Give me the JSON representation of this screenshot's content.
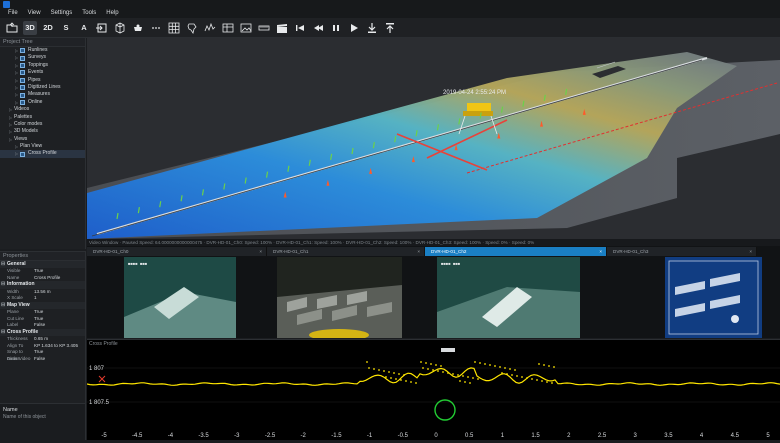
{
  "menu": [
    "File",
    "View",
    "Settings",
    "Tools",
    "Help"
  ],
  "toolbar": {
    "view_3d": "3D",
    "view_2d": "2D",
    "view_s": "S",
    "view_a": "A"
  },
  "project_tree": {
    "title": "Project Tree",
    "items": [
      {
        "label": "Runlines",
        "level": 1,
        "checked": true
      },
      {
        "label": "Surveys",
        "level": 1,
        "checked": true
      },
      {
        "label": "Toppings",
        "level": 1,
        "checked": true
      },
      {
        "label": "Events",
        "level": 1,
        "checked": true
      },
      {
        "label": "Pipes",
        "level": 1,
        "checked": true
      },
      {
        "label": "Digitized Lines",
        "level": 1,
        "checked": true
      },
      {
        "label": "Measures",
        "level": 1,
        "checked": true
      },
      {
        "label": "Online",
        "level": 1,
        "checked": true
      },
      {
        "label": "Videos",
        "level": 0,
        "checked": false
      },
      {
        "label": "Palettes",
        "level": 0,
        "checked": false
      },
      {
        "label": "Color modes",
        "level": 0,
        "checked": false
      },
      {
        "label": "3D Models",
        "level": 0,
        "checked": false
      },
      {
        "label": "Views",
        "level": 0,
        "checked": false
      },
      {
        "label": "Plan View",
        "level": 1,
        "checked": false
      },
      {
        "label": "Cross Profile",
        "level": 1,
        "checked": true
      }
    ]
  },
  "properties": {
    "title": "Properties",
    "sections": [
      {
        "name": "General",
        "rows": [
          [
            "Visible",
            "True"
          ],
          [
            "Name",
            "Cross Profile"
          ]
        ]
      },
      {
        "name": "Information",
        "rows": [
          [
            "Width",
            "13.56 m"
          ],
          [
            "X Scale",
            "1"
          ]
        ]
      },
      {
        "name": "Map View",
        "rows": [
          [
            "Plane",
            "True"
          ],
          [
            "Cut Line",
            "True"
          ],
          [
            "Label",
            "False"
          ]
        ]
      },
      {
        "name": "Cross Profile",
        "rows": [
          [
            "Thickness",
            "0.65 m"
          ],
          [
            "Align To",
            "KP 1.634 to KP 3.405"
          ],
          [
            "Snap to nadas",
            "True"
          ],
          [
            "Dims Video",
            "False"
          ]
        ]
      }
    ]
  },
  "description": {
    "title": "Name",
    "text": "Name of this object"
  },
  "scene": {
    "label": "2019-04-24\n2:55:24 PM"
  },
  "video": {
    "status": "Video Window · Paused Speed: 64.0000000000000475 · DVR-HD-01_Ch0: Speed: 100% · DVR-HD-01_Ch1: Speed: 100% · DVR-HD-01_Ch2: Speed: 100% · DVR-HD-01_Ch3: Speed: 100% · Speed: 0% · Speed: 0%",
    "tabs": [
      {
        "label": "DVR-HD-01_Ch0",
        "active": false
      },
      {
        "label": "DVR-HD-01_Ch1",
        "active": false
      },
      {
        "label": "DVR-HD-01_Ch2",
        "active": true
      },
      {
        "label": "DVR-HD-01_Ch3",
        "active": false
      }
    ]
  },
  "profile": {
    "title": "Cross Profile",
    "y_labels": [
      "1 807",
      "1 807.5"
    ],
    "x_ticks": [
      "-5",
      "-4.5",
      "-4",
      "-3.5",
      "-3",
      "-2.5",
      "-2",
      "-1.5",
      "-1",
      "-0.5",
      "0",
      "0.5",
      "1",
      "1.5",
      "2",
      "2.5",
      "3",
      "3.5",
      "4",
      "4.5",
      "5"
    ]
  },
  "colors": {
    "accent": "#1a7fc4",
    "profile_line": "#ffe600",
    "target_circle": "#22cc33"
  }
}
